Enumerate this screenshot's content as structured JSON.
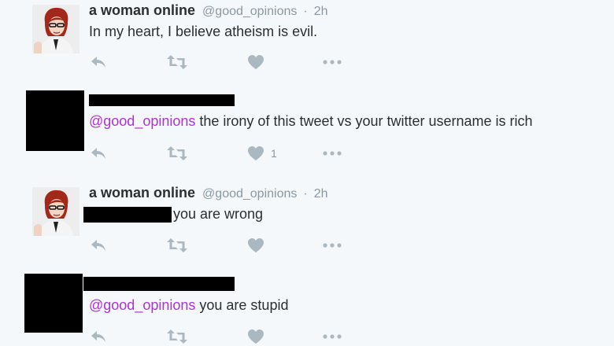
{
  "tweets": [
    {
      "name": "a woman online",
      "handle": "@good_opinions",
      "time": "2h",
      "text": "In my heart, I believe atheism is evil."
    },
    {
      "mention": "@good_opinions",
      "text": " the irony of this tweet vs your twitter username is rich",
      "like_count": "1"
    },
    {
      "name": "a woman online",
      "handle": "@good_opinions",
      "time": "2h",
      "text": "you are wrong"
    },
    {
      "mention": "@good_opinions",
      "text": " you are stupid"
    }
  ],
  "ui": {
    "separator": "·"
  },
  "icons": [
    "reply-icon",
    "retweet-icon",
    "like-icon",
    "more-icon"
  ],
  "colors": {
    "mention": "#b030d8",
    "meta": "#8899a6",
    "icon": "#aab8c2"
  }
}
